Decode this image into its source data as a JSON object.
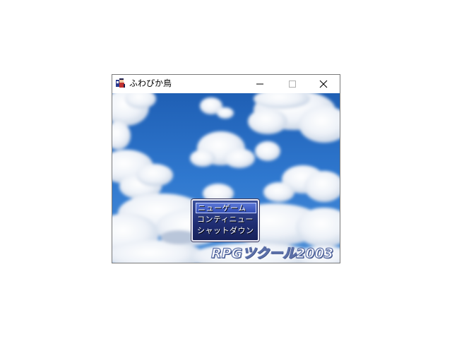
{
  "window": {
    "title": "ふわぴか鳥",
    "controls": {
      "minimize": "minimize-icon",
      "maximize": "maximize-icon",
      "close": "close-icon"
    }
  },
  "game": {
    "background": "sky-with-clouds",
    "menu": {
      "items": [
        {
          "label": "ニューゲーム",
          "selected": true
        },
        {
          "label": "コンティニュー",
          "selected": false
        },
        {
          "label": "シャットダウン",
          "selected": false
        }
      ]
    },
    "logo_text": "RPGツクール2003"
  },
  "colors": {
    "sky": "#2a6fc4",
    "menu_bg": "#1f2d72",
    "menu_selected": "#3450b8",
    "menu_border": "#e8e8f4"
  }
}
